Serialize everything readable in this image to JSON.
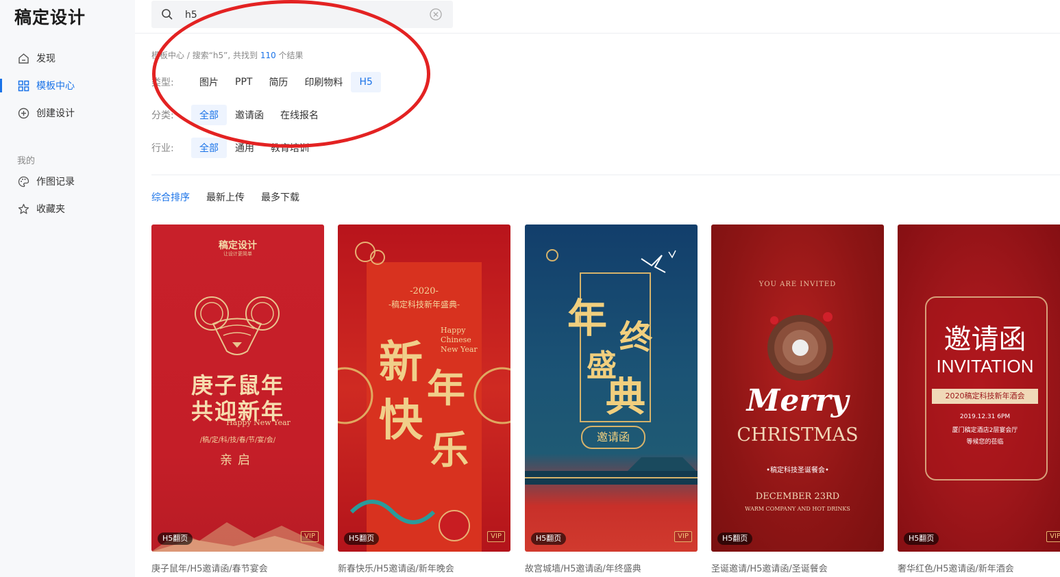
{
  "app": {
    "logo": "稿定设计"
  },
  "sidebar": {
    "items": [
      {
        "label": "发现",
        "icon": "home-icon"
      },
      {
        "label": "模板中心",
        "icon": "grid-icon",
        "active": true
      },
      {
        "label": "创建设计",
        "icon": "plus-circle-icon"
      }
    ],
    "section_title": "我的",
    "my_items": [
      {
        "label": "作图记录",
        "icon": "palette-icon"
      },
      {
        "label": "收藏夹",
        "icon": "star-icon"
      }
    ]
  },
  "search": {
    "value": "h5",
    "icon": "search-icon"
  },
  "breadcrumb": {
    "root": "模板中心",
    "sep": " / ",
    "prefix": "搜索“h5”, 共找到 ",
    "count": "110",
    "suffix": " 个结果"
  },
  "filters": {
    "type": {
      "label": "类型:",
      "options": [
        "图片",
        "PPT",
        "简历",
        "印刷物料",
        "H5"
      ],
      "selected": "H5"
    },
    "category": {
      "label": "分类:",
      "options": [
        "全部",
        "邀请函",
        "在线报名"
      ],
      "selected": "全部"
    },
    "industry": {
      "label": "行业:",
      "options": [
        "全部",
        "通用",
        "教育培训"
      ],
      "selected": "全部"
    }
  },
  "sort": {
    "options": [
      "综合排序",
      "最新上传",
      "最多下载"
    ],
    "selected": "综合排序"
  },
  "cards": [
    {
      "caption": "庚子鼠年/H5邀请函/春节宴会",
      "badge": "H5翻页",
      "vip": "VIP",
      "poster": {
        "brand": "稿定设计",
        "tagline": "让设计更简单",
        "title1": "庚子鼠年",
        "title2": "共迎新年",
        "subtitle": "Happy New Year",
        "line": "/稿/定/科/技/春/节/宴/会/",
        "footer": "亲启"
      }
    },
    {
      "caption": "新春快乐/H5邀请函/新年晚会",
      "badge": "H5翻页",
      "vip": "VIP",
      "poster": {
        "year": "-2020-",
        "event": "-稿定科技新年盛典-",
        "english": "Happy Chinese New Year",
        "c1": "新",
        "c2": "年",
        "c3": "快",
        "c4": "乐"
      }
    },
    {
      "caption": "故宫城墙/H5邀请函/年终盛典",
      "badge": "H5翻页",
      "vip": "VIP",
      "poster": {
        "c1": "年",
        "c2": "终",
        "c3": "盛",
        "c4": "典",
        "seal": "邀请函"
      }
    },
    {
      "caption": "圣诞邀请/H5邀请函/圣诞餐会",
      "badge": "H5翻页",
      "poster": {
        "invite": "YOU ARE INVITED",
        "merry": "Merry",
        "christmas": "CHRISTMAS",
        "event": "•稿定科技圣诞餐会•",
        "date": "DECEMBER 23RD",
        "note": "WARM COMPANY AND HOT DRINKS"
      }
    },
    {
      "caption": "奢华红色/H5邀请函/新年酒会",
      "badge": "H5翻页",
      "vip": "VIP",
      "poster": {
        "title": "邀请函",
        "english": "INVITATION",
        "banner": "2020稿定科技新年酒会",
        "time": "2019.12.31   6PM",
        "place": "厦门稿定酒店2层宴会厅",
        "wait": "等候您的莅临"
      }
    }
  ],
  "colors": {
    "accent": "#1a73e8",
    "annotation": "#e32222"
  }
}
